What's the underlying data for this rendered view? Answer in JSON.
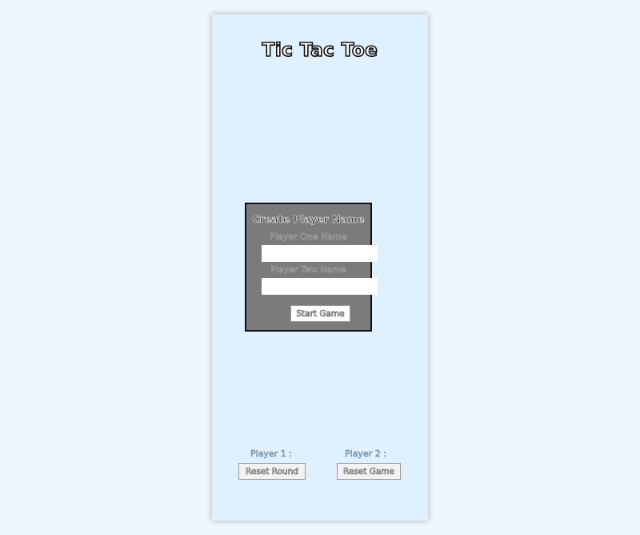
{
  "app": {
    "title": "Tic Tac Toe"
  },
  "name_modal": {
    "heading": "Create Player Name",
    "player_one_label": "Player One Name",
    "player_one_value": "",
    "player_two_label": "Player Two Name",
    "player_two_value": "",
    "start_button_label": "Start Game"
  },
  "scoreboard": {
    "player_one_label": "Player 1 :",
    "player_two_label": "Player 2 :",
    "reset_round_label": "Reset Round",
    "reset_game_label": "Reset Game"
  },
  "colors": {
    "page_background": "#eef7fe",
    "card_background": "#dff0fe",
    "modal_background": "#7b7b7b"
  }
}
